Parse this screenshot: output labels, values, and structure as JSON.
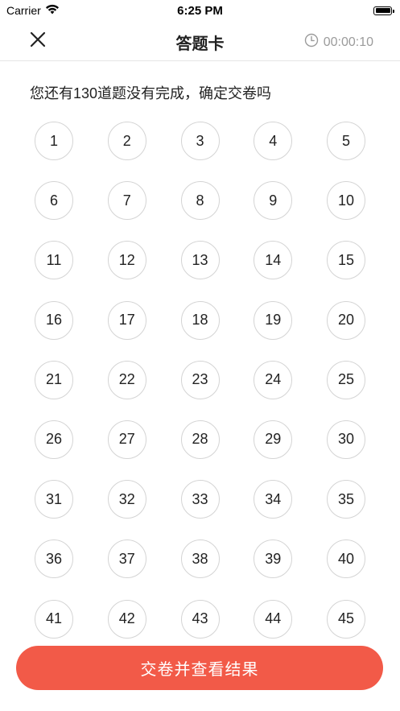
{
  "status_bar": {
    "carrier": "Carrier",
    "time": "6:25 PM"
  },
  "header": {
    "title": "答题卡",
    "timer": "00:00:10",
    "close_icon": "close-icon",
    "clock_icon": "clock-icon"
  },
  "message": "您还有130道题没有完成，确定交卷吗",
  "questions": [
    "1",
    "2",
    "3",
    "4",
    "5",
    "6",
    "7",
    "8",
    "9",
    "10",
    "11",
    "12",
    "13",
    "14",
    "15",
    "16",
    "17",
    "18",
    "19",
    "20",
    "21",
    "22",
    "23",
    "24",
    "25",
    "26",
    "27",
    "28",
    "29",
    "30",
    "31",
    "32",
    "33",
    "34",
    "35",
    "36",
    "37",
    "38",
    "39",
    "40",
    "41",
    "42",
    "43",
    "44",
    "45"
  ],
  "submit_label": "交卷并查看结果",
  "colors": {
    "accent": "#f25a48",
    "timer_text": "#9b9b9b",
    "circle_border": "#d4d4d4"
  }
}
